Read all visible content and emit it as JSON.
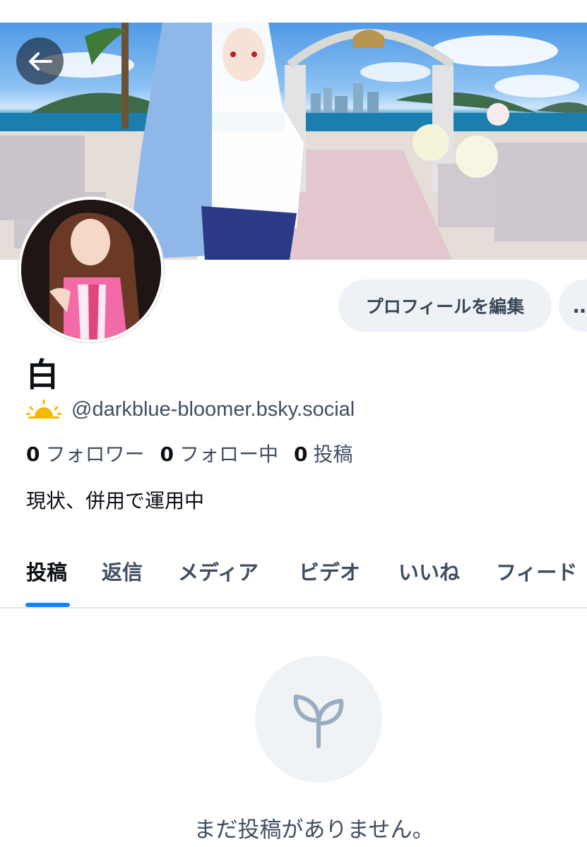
{
  "header": {
    "back_icon": "arrow-left-icon"
  },
  "profile": {
    "display_name": "白",
    "status_emoji_icon": "sunrise-icon",
    "handle": "@darkblue-bloomer.bsky.social",
    "followers_count": "0",
    "followers_label": "フォロワー",
    "following_count": "0",
    "following_label": "フォロー中",
    "posts_count": "0",
    "posts_label": "投稿",
    "bio": "現状、併用で運用中"
  },
  "actions": {
    "edit_profile_label": "プロフィールを編集",
    "more_label": "…"
  },
  "tabs": [
    {
      "label": "投稿",
      "active": true
    },
    {
      "label": "返信",
      "active": false
    },
    {
      "label": "メディア",
      "active": false
    },
    {
      "label": "ビデオ",
      "active": false
    },
    {
      "label": "いいね",
      "active": false
    },
    {
      "label": "フィード",
      "active": false
    }
  ],
  "empty_state": {
    "icon": "seedling-icon",
    "message": "まだ投稿がありません。"
  },
  "colors": {
    "accent": "#1083fe",
    "text_primary": "#0b0f14",
    "text_secondary": "#3f4e61",
    "button_bg": "#eef2f6"
  }
}
